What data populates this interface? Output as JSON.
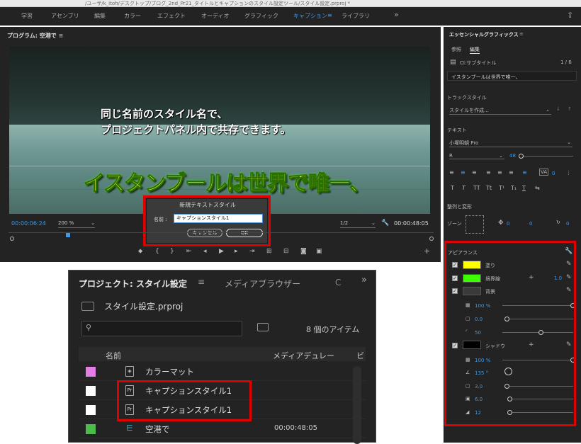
{
  "window": {
    "title": "/ユーザ/k_itoh/デスクトップ/ブログ_2nd_Pr21_タイトルとキャプションのスタイル設定ツール/スタイル設定.prproj *"
  },
  "workspaces": {
    "tabs": [
      "学習",
      "アセンブリ",
      "編集",
      "カラー",
      "エフェクト",
      "オーディオ",
      "グラフィック",
      "キャプション",
      "ライブラリ"
    ],
    "active": "キャプション",
    "more": "»"
  },
  "program": {
    "title": "プログラム: 空港で",
    "caption_line1": "同じ名前のスタイル名で、",
    "caption_line2": "プロジェクトパネル内で共存できます。",
    "subtitle": "イスタンブールは世界で唯一、",
    "timecode_in": "00:00:06:24",
    "zoom": "200 %",
    "resolution": "1/2",
    "timecode_total": "00:00:48:05"
  },
  "dialog": {
    "title": "新規テキストスタイル",
    "name_label": "名前 :",
    "name_value": "キャプションスタイル1",
    "cancel": "キャンセル",
    "ok": "OK"
  },
  "essential_graphics": {
    "title": "エッセンシャルグラフィックス",
    "tab_browse": "参照",
    "tab_edit": "編集",
    "layer_name": "CI:サブタイトル",
    "layer_page": "1 / 6",
    "text_preview": "イスタンブールは世界で唯一、",
    "track_style_header": "トラックスタイル",
    "track_style_value": "スタイルを作成...",
    "text_header": "テキスト",
    "font": "小塚明朝 Pro",
    "font_style": "R",
    "font_size": "48",
    "tracking": "0",
    "align_transform_header": "整列と変形",
    "zone_label": "ゾーン",
    "pos_x": "0",
    "pos_y": "0",
    "rotation": "0",
    "appearance_header": "アピアランス",
    "fill_label": "塗り",
    "stroke_label": "境界線",
    "stroke_width": "1.0",
    "background_label": "背景",
    "bg_opacity": "100 %",
    "bg_size": "0.0",
    "bg_corner": "50",
    "shadow_label": "シャドウ",
    "shadow_opacity": "100 %",
    "shadow_angle": "135 °",
    "shadow_distance": "3.0",
    "shadow_size": "6.0",
    "shadow_blur": "12",
    "fill_color": "#ffff00",
    "stroke_color": "#3cff00",
    "shadow_color": "#000000"
  },
  "project": {
    "title": "プロジェクト: スタイル設定",
    "menu_icon": "≡",
    "media_tab": "メディアブラウザー",
    "file": "スタイル設定.prproj",
    "item_count": "8 個のアイテム",
    "col_name": "名前",
    "col_duration": "メディアデュレー",
    "col_extra": "ビ",
    "rows": [
      {
        "name": "カラーマット",
        "duration": "",
        "chip": "#e27ee6"
      },
      {
        "name": "キャプションスタイル1",
        "duration": "",
        "chip": "#ffffff"
      },
      {
        "name": "キャプションスタイル1",
        "duration": "",
        "chip": "#ffffff"
      },
      {
        "name": "空港で",
        "duration": "00:00:48:05",
        "chip": "#4cbb4c"
      }
    ]
  }
}
